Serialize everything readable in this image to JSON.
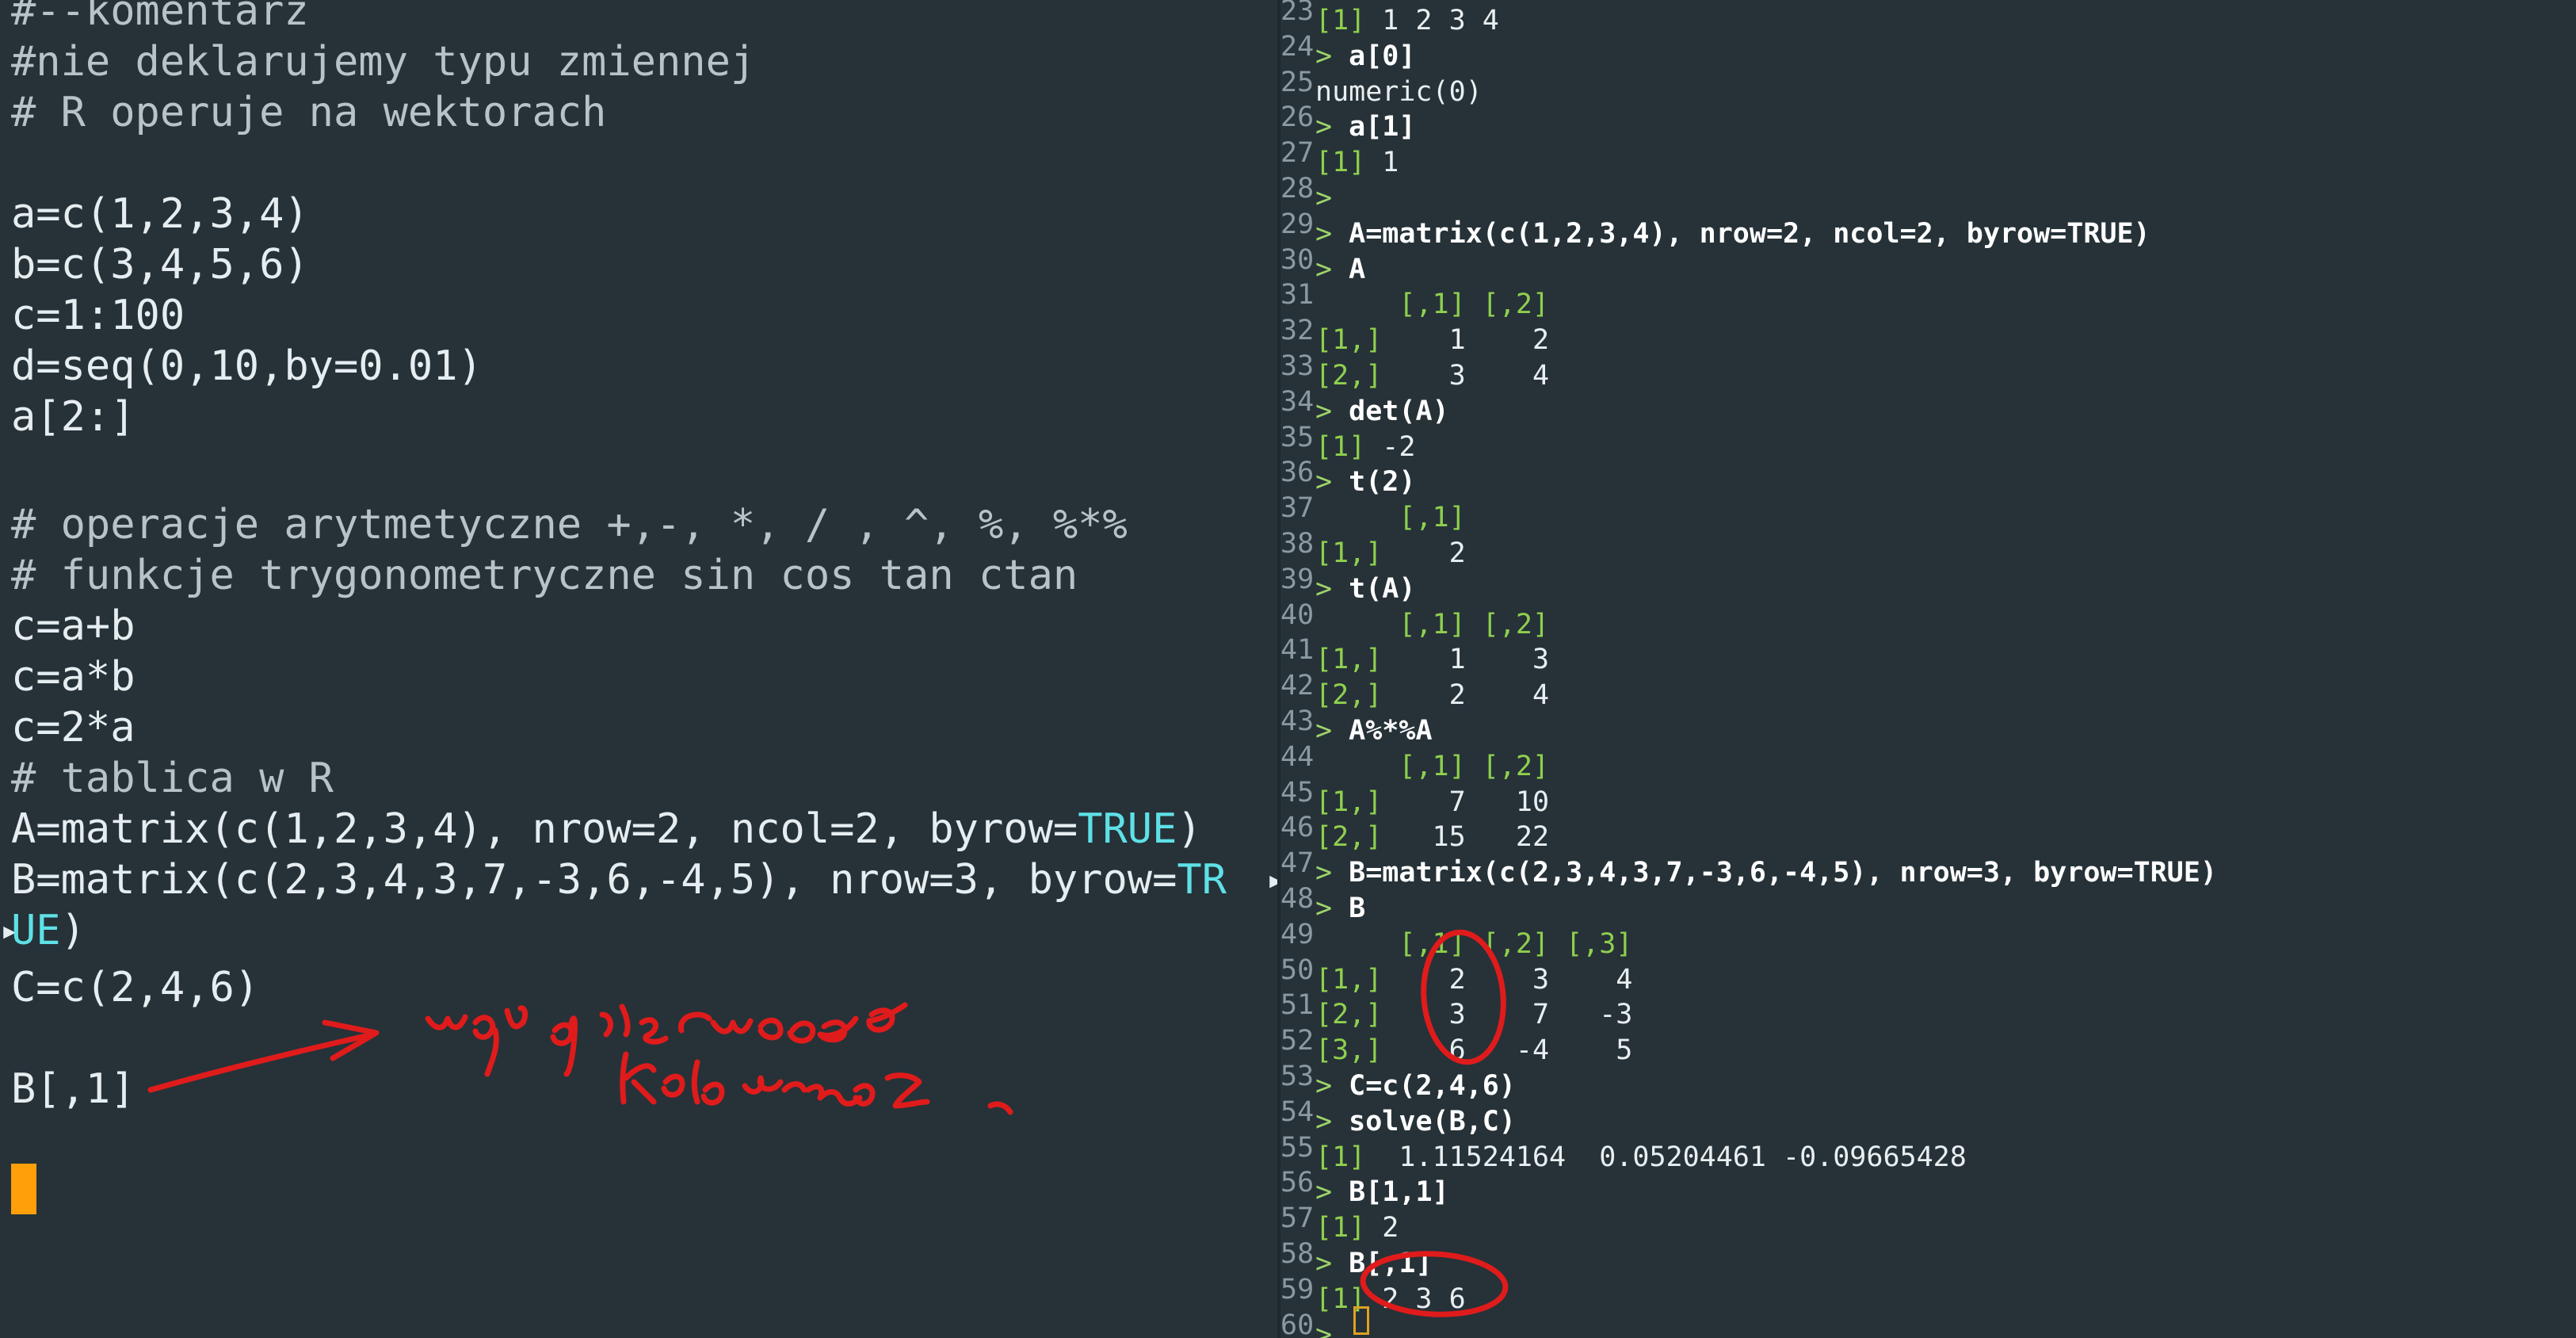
{
  "editor": {
    "lines": [
      "#--komentarz",
      "#nie deklarujemy typu zmiennej",
      "# R operuje na wektorach",
      "",
      "a=c(1,2,3,4)",
      "b=c(3,4,5,6)",
      "c=1:100",
      "d=seq(0,10,by=0.01)",
      "a[2:]",
      "",
      "# operacje arytmetyczne +,-, *, / , ^, %, %*%",
      "# funkcje trygonometryczne sin cos tan ctan",
      "c=a+b",
      "c=a*b",
      "c=2*a",
      "# tablica w R",
      "A=matrix(c(1,2,3,4), nrow=2, ncol=2, byrow=",
      "B=matrix(c(2,3,4,3,7,-3,6,-4,5), nrow=3, byrow=",
      "",
      "C=c(2,4,6)",
      "",
      "B[,1]"
    ],
    "line16_keyword": "TRUE",
    "line16_tail": ")",
    "line17_keyword": "TR",
    "line18_keyword": "UE",
    "line18_tail": ")",
    "wrap_marker": "▸"
  },
  "handwriting": {
    "note": "wypisz pierwszą kolumnę"
  },
  "terminal": {
    "lines": [
      {
        "n": "23",
        "type": "idx",
        "idx": "[1]",
        "text": " 1 2 3 4"
      },
      {
        "n": "24",
        "type": "cmd",
        "prompt": "> ",
        "text": "a[0]"
      },
      {
        "n": "25",
        "type": "out",
        "text": "numeric(0)"
      },
      {
        "n": "26",
        "type": "cmd",
        "prompt": "> ",
        "text": "a[1]"
      },
      {
        "n": "27",
        "type": "idx",
        "idx": "[1]",
        "text": " 1"
      },
      {
        "n": "28",
        "type": "cmd",
        "prompt": ">",
        "text": ""
      },
      {
        "n": "29",
        "type": "cmd",
        "prompt": "> ",
        "text": "A=matrix(c(1,2,3,4), nrow=2, ncol=2, byrow=TRUE)"
      },
      {
        "n": "30",
        "type": "cmd",
        "prompt": "> ",
        "text": "A"
      },
      {
        "n": "31",
        "type": "idx",
        "idx": "     [,1] [,2]",
        "text": ""
      },
      {
        "n": "32",
        "type": "idx",
        "idx": "[1,]",
        "text": "    1    2"
      },
      {
        "n": "33",
        "type": "idx",
        "idx": "[2,]",
        "text": "    3    4"
      },
      {
        "n": "34",
        "type": "cmd",
        "prompt": "> ",
        "text": "det(A)"
      },
      {
        "n": "35",
        "type": "idx",
        "idx": "[1]",
        "text": " -2"
      },
      {
        "n": "36",
        "type": "cmd",
        "prompt": "> ",
        "text": "t(2)"
      },
      {
        "n": "37",
        "type": "idx",
        "idx": "     [,1]",
        "text": ""
      },
      {
        "n": "38",
        "type": "idx",
        "idx": "[1,]",
        "text": "    2"
      },
      {
        "n": "39",
        "type": "cmd",
        "prompt": "> ",
        "text": "t(A)"
      },
      {
        "n": "40",
        "type": "idx",
        "idx": "     [,1] [,2]",
        "text": ""
      },
      {
        "n": "41",
        "type": "idx",
        "idx": "[1,]",
        "text": "    1    3"
      },
      {
        "n": "42",
        "type": "idx",
        "idx": "[2,]",
        "text": "    2    4"
      },
      {
        "n": "43",
        "type": "cmd",
        "prompt": "> ",
        "text": "A%*%A"
      },
      {
        "n": "44",
        "type": "idx",
        "idx": "     [,1] [,2]",
        "text": ""
      },
      {
        "n": "45",
        "type": "idx",
        "idx": "[1,]",
        "text": "    7   10"
      },
      {
        "n": "46",
        "type": "idx",
        "idx": "[2,]",
        "text": "   15   22"
      },
      {
        "n": "47",
        "type": "cmd",
        "prompt": "> ",
        "text": "B=matrix(c(2,3,4,3,7,-3,6,-4,5), nrow=3, byrow=TRUE)"
      },
      {
        "n": "48",
        "type": "cmd",
        "prompt": "> ",
        "text": "B"
      },
      {
        "n": "49",
        "type": "idx",
        "idx": "     [,1] [,2] [,3]",
        "text": ""
      },
      {
        "n": "50",
        "type": "idx",
        "idx": "[1,]",
        "text": "    2    3    4"
      },
      {
        "n": "51",
        "type": "idx",
        "idx": "[2,]",
        "text": "    3    7   -3"
      },
      {
        "n": "52",
        "type": "idx",
        "idx": "[3,]",
        "text": "    6   -4    5"
      },
      {
        "n": "53",
        "type": "cmd",
        "prompt": "> ",
        "text": "C=c(2,4,6)"
      },
      {
        "n": "54",
        "type": "cmd",
        "prompt": "> ",
        "text": "solve(B,C)"
      },
      {
        "n": "55",
        "type": "idx",
        "idx": "[1]",
        "text": "  1.11524164  0.05204461 -0.09665428"
      },
      {
        "n": "56",
        "type": "cmd",
        "prompt": "> ",
        "text": "B[1,1]"
      },
      {
        "n": "57",
        "type": "idx",
        "idx": "[1]",
        "text": " 2"
      },
      {
        "n": "58",
        "type": "cmd",
        "prompt": "> ",
        "text": "B[,1]"
      },
      {
        "n": "59",
        "type": "idx",
        "idx": "[1]",
        "text": " 2 3 6"
      },
      {
        "n": "60",
        "type": "cmd",
        "prompt": "> ",
        "text": ""
      }
    ]
  },
  "colors": {
    "background": "#263238",
    "keyword": "#5ee1e6",
    "cursor": "#ff9f0a",
    "ink": "#e01b1b",
    "index": "#8fcf4e"
  }
}
